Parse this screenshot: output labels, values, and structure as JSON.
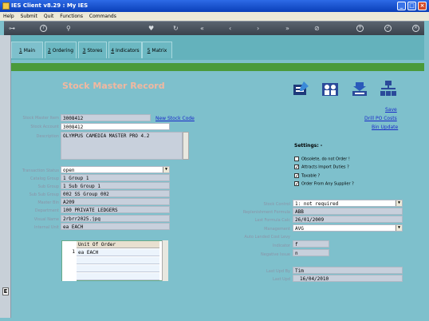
{
  "window": {
    "title": "IES Client v8.29 : My IES",
    "minimize": "_",
    "maximize": "□",
    "close": "×"
  },
  "menu": [
    "Help",
    "Submit",
    "Quit",
    "Functions",
    "Commands"
  ],
  "tabs": [
    {
      "num": "1",
      "label": "Main"
    },
    {
      "num": "2",
      "label": "Ordering"
    },
    {
      "num": "3",
      "label": "Stores"
    },
    {
      "num": "4",
      "label": "Indicators"
    },
    {
      "num": "5",
      "label": "Matrix"
    }
  ],
  "heading": "Stock Master Record",
  "links": {
    "new_stock_code": "New Stock Code",
    "save": "Save",
    "drill_po_costs": "Drill PO Costs",
    "bin_update": "Bin Update"
  },
  "labels": {
    "stock_master_item": "Stock Master Item",
    "stock_account": "Stock Account",
    "description": "Description",
    "transaction_status": "Transaction Status",
    "catalog_group": "Catalog Group",
    "sub_group": "Sub Group",
    "sub_sub_group": "Sub Sub Group",
    "master_bin": "Master Bin",
    "department": "Department",
    "visual_name": "Visual Name",
    "internal_unit": "Internal Unit",
    "stock_control": "Stock Control",
    "replenishment_formula": "Replenishment Formula",
    "last_formula_calc": "Last Formula Calc",
    "management": "Management",
    "auto_landed_cost_levy": "Auto Landed Cost Levy",
    "indicator": "Indicator",
    "negative_issue": "Negative Issue",
    "last_upd_by": "Last Upd By",
    "last_upd": "Last Upd"
  },
  "values": {
    "stock_master_item": "3008412",
    "stock_account": "3008412",
    "description": "OLYMPUS CAMEDIA MASTER PRO 4.2",
    "transaction_status": "open",
    "catalog_group": "1 Group 1",
    "sub_group": "1 Sub Group 1",
    "sub_sub_group": "002 SS Group 002",
    "master_bin": "A209",
    "department": "100 PRIVATE LEDGERS",
    "visual_name": "2rbrr2025.jpg",
    "internal_unit": "ea EACH",
    "stock_control": "1: not required",
    "replenishment_formula": "ABB",
    "last_formula_calc": "26/01/2009",
    "management": "AVG",
    "auto_landed_cost_levy": "",
    "indicator": "f",
    "negative_issue": "n",
    "last_upd_by": "Tim",
    "last_upd": "16/04/2010"
  },
  "settings": {
    "title": "Settings: -",
    "checks": [
      {
        "label": "Obsolete, do not Order !",
        "checked": false
      },
      {
        "label": "Attracts Import Duties ?",
        "checked": true
      },
      {
        "label": "Taxable ?",
        "checked": true
      },
      {
        "label": "Order From Any Supplier ?",
        "checked": true
      }
    ]
  },
  "grid": {
    "header": "Unit Of Order",
    "rows": [
      {
        "n": "1",
        "value": "ea EACH"
      },
      {
        "n": "",
        "value": ""
      },
      {
        "n": "",
        "value": ""
      },
      {
        "n": "",
        "value": ""
      }
    ]
  },
  "sidebar_letter": "E"
}
